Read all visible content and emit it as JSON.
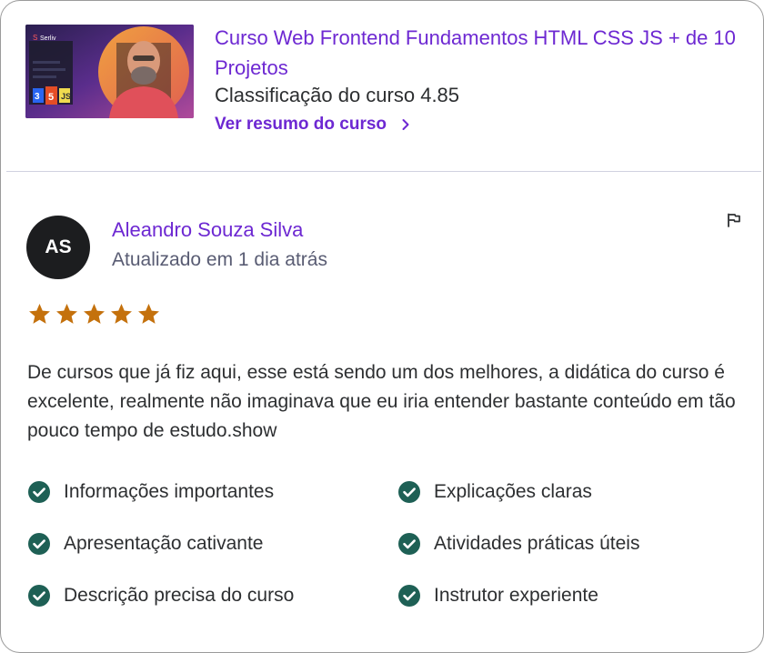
{
  "course": {
    "title": "Curso Web Frontend Fundamentos HTML CSS JS + de 10 Projetos",
    "rating_text": "Classificação do curso 4.85",
    "link_label": "Ver resumo do curso",
    "thumbnail_icon": "instructor-photo",
    "thumbnail_brand": "Serliv"
  },
  "review": {
    "avatar_initials": "AS",
    "reviewer_name": "Aleandro Souza Silva",
    "date": "Atualizado em 1 dia atrás",
    "stars": 5,
    "text": "De cursos que já fiz aqui, esse está sendo um dos melhores, a didática do curso é excelente, realmente não imaginava que eu iria entender bastante conteúdo em tão pouco tempo de estudo.show",
    "flag_icon": "flag-icon"
  },
  "tags": [
    "Informações importantes",
    "Explicações claras",
    "Apresentação cativante",
    "Atividades práticas úteis",
    "Descrição precisa do curso",
    "Instrutor experiente"
  ],
  "colors": {
    "accent": "#6d28d2",
    "star": "#c4710d",
    "check": "#1e6055",
    "text": "#2d2f31",
    "muted": "#595c73"
  }
}
